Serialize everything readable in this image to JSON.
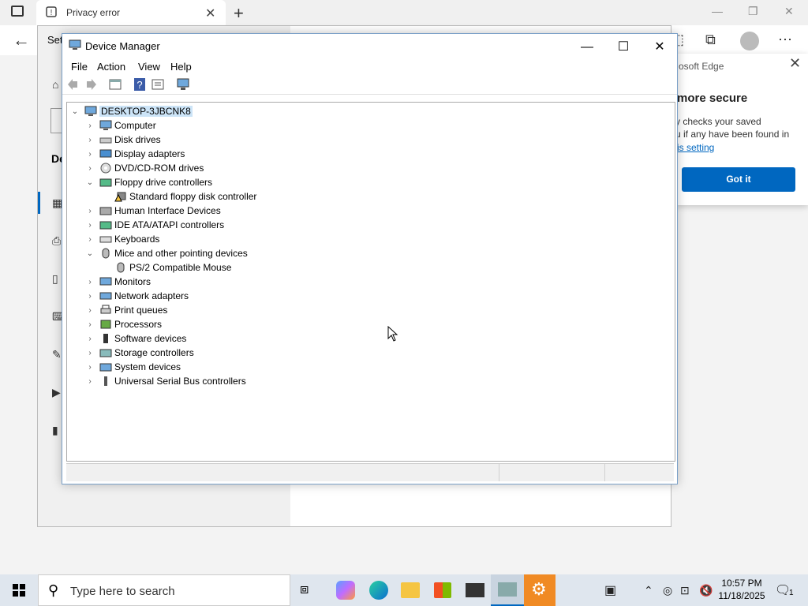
{
  "browser": {
    "tab_title": "Privacy error",
    "new_tab_symbol": "+",
    "close_symbol": "✕"
  },
  "settings": {
    "title_fragment": "Set",
    "section_fragment": "De"
  },
  "edge_popup": {
    "header": "osoft Edge",
    "title": "more secure",
    "body_line1": "y checks your saved",
    "body_line2": "u if any have been found in",
    "link": "is setting",
    "button": "Got it"
  },
  "device_manager": {
    "title": "Device Manager",
    "menu": [
      "File",
      "Action",
      "View",
      "Help"
    ],
    "root": "DESKTOP-3JBCNK8",
    "tree": [
      {
        "label": "Computer",
        "expanded": false,
        "icon": "computer-icon"
      },
      {
        "label": "Disk drives",
        "expanded": false,
        "icon": "disk-icon"
      },
      {
        "label": "Display adapters",
        "expanded": false,
        "icon": "display-icon"
      },
      {
        "label": "DVD/CD-ROM drives",
        "expanded": false,
        "icon": "dvd-icon"
      },
      {
        "label": "Floppy drive controllers",
        "expanded": true,
        "icon": "floppy-controller-icon"
      },
      {
        "label": "Standard floppy disk controller",
        "child": true,
        "icon": "warning-device-icon"
      },
      {
        "label": "Human Interface Devices",
        "expanded": false,
        "icon": "hid-icon"
      },
      {
        "label": "IDE ATA/ATAPI controllers",
        "expanded": false,
        "icon": "ide-icon"
      },
      {
        "label": "Keyboards",
        "expanded": false,
        "icon": "keyboard-icon"
      },
      {
        "label": "Mice and other pointing devices",
        "expanded": true,
        "icon": "mouse-icon"
      },
      {
        "label": "PS/2 Compatible Mouse",
        "child": true,
        "icon": "mouse-icon"
      },
      {
        "label": "Monitors",
        "expanded": false,
        "icon": "monitor-icon"
      },
      {
        "label": "Network adapters",
        "expanded": false,
        "icon": "network-icon"
      },
      {
        "label": "Print queues",
        "expanded": false,
        "icon": "printer-icon"
      },
      {
        "label": "Processors",
        "expanded": false,
        "icon": "processor-icon"
      },
      {
        "label": "Software devices",
        "expanded": false,
        "icon": "software-device-icon"
      },
      {
        "label": "Storage controllers",
        "expanded": false,
        "icon": "storage-icon"
      },
      {
        "label": "System devices",
        "expanded": false,
        "icon": "system-devices-icon"
      },
      {
        "label": "Universal Serial Bus controllers",
        "expanded": false,
        "icon": "usb-icon"
      }
    ]
  },
  "taskbar": {
    "search_placeholder": "Type here to search",
    "time": "10:57 PM",
    "date": "11/18/2025",
    "notification_count": "1"
  },
  "colors": {
    "accent": "#0067c0",
    "selection": "#cce4f7",
    "taskbar": "#dfe6ee"
  }
}
